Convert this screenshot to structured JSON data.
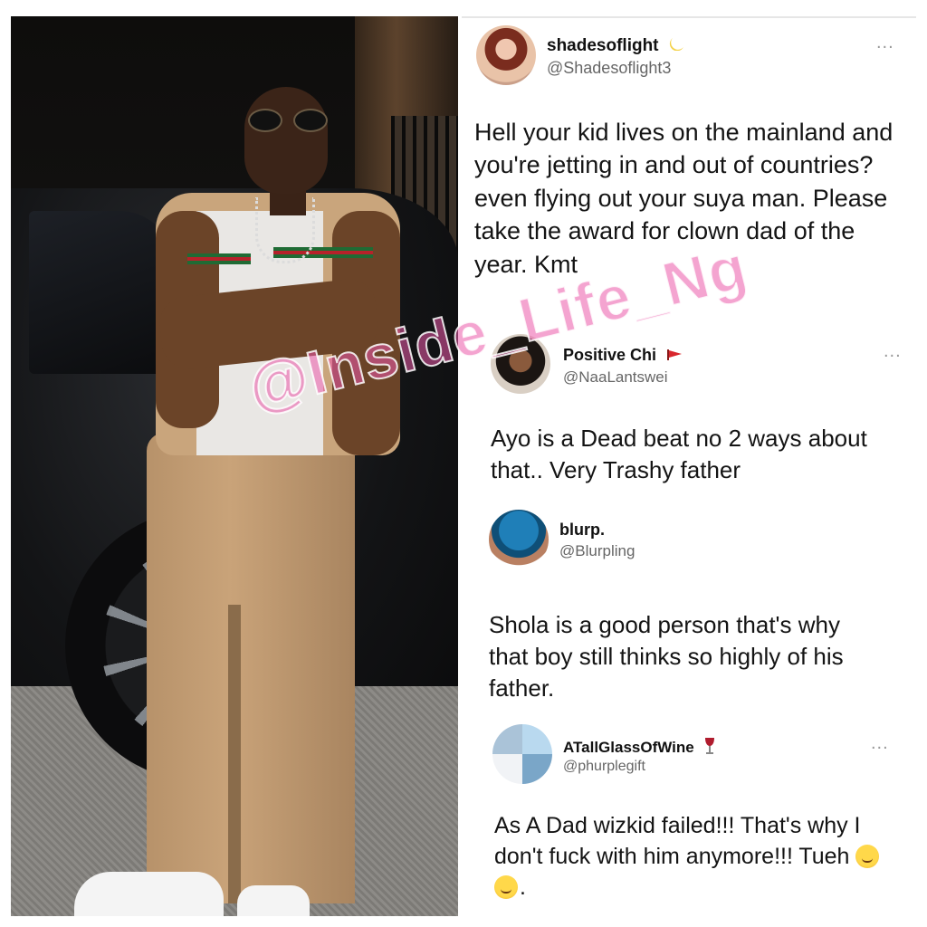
{
  "watermark": "@Inside_Life_Ng",
  "tweets": [
    {
      "name": "shadesoflight",
      "badge_icon": "crescent-moon-emoji",
      "handle": "@Shadesoflight3",
      "more": "...",
      "text": "Hell your kid lives on the mainland and you're jetting in and out of countries? even flying out your suya man. Please take the award for clown dad of the year. Kmt"
    },
    {
      "name": "Positive Chi",
      "badge_icon": "red-flag-emoji",
      "handle": "@NaaLantswei",
      "more": "...",
      "text": "Ayo is a Dead beat no 2 ways about that.. Very Trashy father"
    },
    {
      "name": "blurp.",
      "handle": "@Blurpling",
      "text": "Shola is a good person that's why that boy still thinks so highly of his father."
    },
    {
      "name": "ATallGlassOfWine",
      "badge_icon": "wine-glass-emoji",
      "handle": "@phurplegift",
      "more": "...",
      "text": "As A Dad wizkid failed!!! That's why I don't fuck with him anymore!!! Tueh",
      "trailing_emojis": [
        "smirking-face-emoji",
        "smirking-face-emoji"
      ],
      "trailing_text": "."
    }
  ],
  "colors": {
    "watermark": "#eb5aaa",
    "text": "#141414",
    "handle": "#666666"
  }
}
